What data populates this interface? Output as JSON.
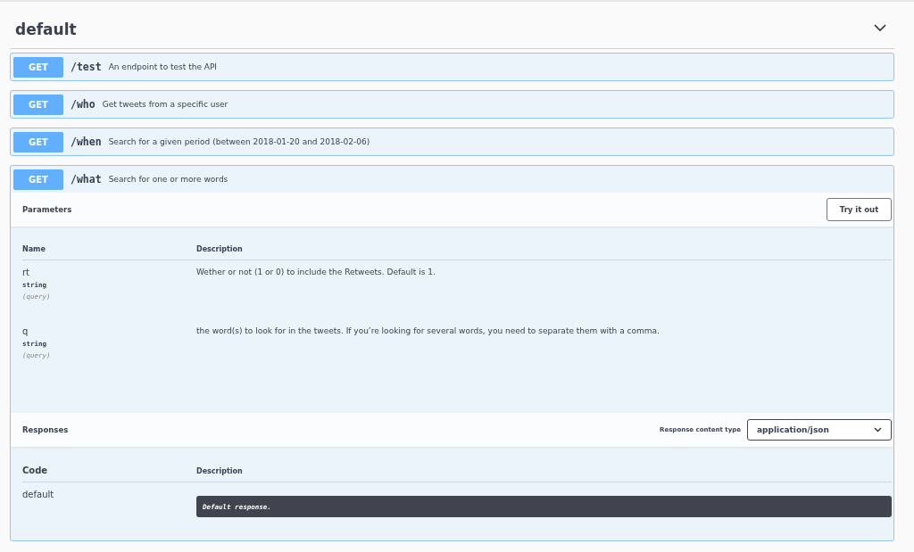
{
  "section": {
    "title": "default",
    "expanded": true
  },
  "operations": [
    {
      "method": "GET",
      "path": "/test",
      "summary": "An endpoint to test the API"
    },
    {
      "method": "GET",
      "path": "/who",
      "summary": "Get tweets from a specific user"
    },
    {
      "method": "GET",
      "path": "/when",
      "summary": "Search for a given period (between 2018-01-20 and 2018-02-06)"
    },
    {
      "method": "GET",
      "path": "/what",
      "summary": "Search for one or more words",
      "expanded": true,
      "parameters": {
        "title": "Parameters",
        "try_button": "Try it out",
        "columns": [
          "Name",
          "Description"
        ],
        "rows": [
          {
            "name": "rt",
            "type": "string",
            "in": "(query)",
            "description": "Wether or not (1 or 0) to include the Retweets. Default is 1."
          },
          {
            "name": "q",
            "type": "string",
            "in": "(query)",
            "description": "the word(s) to look for in the tweets. If you’re looking for several words, you need to separate them with a comma."
          }
        ]
      },
      "responses": {
        "title": "Responses",
        "content_type_label": "Response content type",
        "content_type": "application/json",
        "columns": [
          "Code",
          "Description"
        ],
        "rows": [
          {
            "code": "default",
            "description": "Default response."
          }
        ]
      }
    }
  ]
}
